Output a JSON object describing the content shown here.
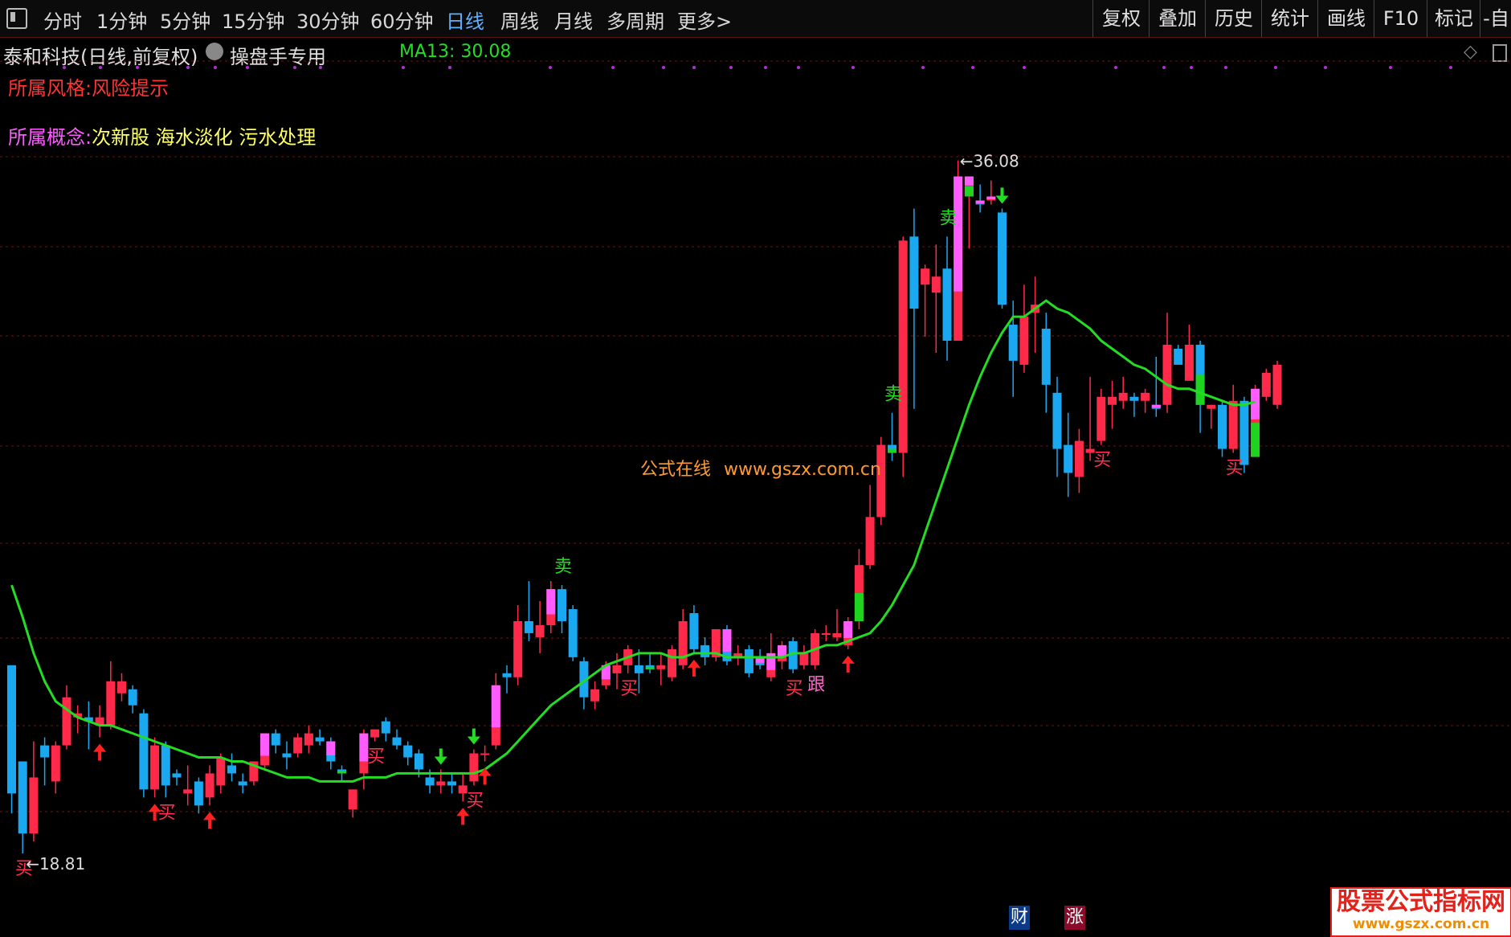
{
  "toolbar": {
    "periods": [
      "分时",
      "1分钟",
      "5分钟",
      "15分钟",
      "30分钟",
      "60分钟",
      "日线",
      "周线",
      "月线",
      "多周期",
      "更多>"
    ],
    "active_period": "日线",
    "right_buttons": [
      "复权",
      "叠加",
      "历史",
      "统计",
      "画线",
      "F10",
      "标记",
      "-自"
    ]
  },
  "header": {
    "stock_title": "泰和科技(日线,前复权)",
    "indicator_name": "操盘手专用",
    "ma_label": "MA13: 30.08",
    "style_prefix": "所属风格:",
    "style_value": "风险提示",
    "concept_prefix": "所属概念:",
    "concepts": "次新股 海水淡化 污水处理"
  },
  "watermark": {
    "cn": "公式在线",
    "url": "www.gszx.com.cn"
  },
  "bottom_badges": {
    "cai": "财",
    "zhang": "涨"
  },
  "logo": {
    "line1": "股票公式指标网",
    "line2": "www.gszx.com.cn"
  },
  "colors": {
    "up": "#ff2a4a",
    "down": "#1aa8f0",
    "magenta": "#ff5cff",
    "green": "#1fd41f",
    "ma": "#22dd22",
    "grid": "#7a1010",
    "dots": "#b030d0"
  },
  "chart_data": {
    "type": "candlestick",
    "title": "泰和科技(日线,前复权)",
    "ylim": [
      17.7,
      38.7
    ],
    "max_label": "36.08",
    "min_label": "18.81",
    "candles": [
      [
        23.5,
        20.3,
        23.5,
        19.8
      ],
      [
        21.1,
        19.3,
        21.1,
        18.8
      ],
      [
        19.3,
        20.7,
        21.6,
        19.1
      ],
      [
        21.5,
        21.2,
        21.7,
        20.5
      ],
      [
        20.6,
        21.5,
        21.6,
        20.3
      ],
      [
        21.5,
        22.7,
        23.0,
        21.4
      ],
      [
        22.2,
        22.3,
        22.5,
        21.8
      ],
      [
        22.2,
        22.1,
        22.6,
        21.4
      ],
      [
        22.0,
        22.2,
        22.5,
        21.7
      ],
      [
        22.0,
        23.1,
        23.6,
        21.9
      ],
      [
        22.8,
        23.1,
        23.3,
        22.6
      ],
      [
        22.9,
        22.5,
        23.0,
        22.3
      ],
      [
        22.3,
        20.4,
        22.4,
        20.2
      ],
      [
        20.4,
        21.5,
        21.7,
        20.2
      ],
      [
        21.5,
        20.5,
        21.6,
        20.2
      ],
      [
        20.8,
        20.7,
        20.9,
        20.5
      ],
      [
        20.3,
        20.4,
        21.0,
        20.0
      ],
      [
        20.6,
        20.0,
        20.7,
        19.8
      ],
      [
        20.2,
        20.8,
        21.0,
        20.0
      ],
      [
        20.5,
        21.2,
        21.3,
        20.3
      ],
      [
        21.0,
        20.8,
        21.3,
        20.6
      ],
      [
        20.6,
        20.5,
        20.8,
        20.3
      ],
      [
        20.6,
        21.1,
        21.1,
        20.5
      ],
      [
        21.0,
        21.8,
        21.8,
        20.9
      ],
      [
        21.8,
        21.5,
        21.9,
        21.3
      ],
      [
        21.3,
        21.2,
        21.6,
        20.9
      ],
      [
        21.3,
        21.7,
        21.8,
        21.2
      ],
      [
        21.5,
        21.8,
        22.0,
        21.3
      ],
      [
        21.7,
        21.6,
        21.9,
        21.5
      ],
      [
        21.6,
        21.1,
        21.7,
        20.9
      ],
      [
        20.9,
        20.8,
        21.0,
        20.6
      ],
      [
        19.9,
        20.4,
        20.4,
        19.7
      ],
      [
        20.8,
        21.8,
        21.9,
        20.4
      ],
      [
        21.7,
        21.9,
        21.9,
        21.6
      ],
      [
        22.1,
        21.8,
        22.2,
        21.6
      ],
      [
        21.7,
        21.5,
        21.9,
        21.4
      ],
      [
        21.5,
        21.2,
        21.6,
        21.0
      ],
      [
        21.3,
        20.9,
        21.4,
        20.7
      ],
      [
        20.7,
        20.5,
        20.9,
        20.3
      ],
      [
        20.5,
        20.6,
        20.9,
        20.3
      ],
      [
        20.6,
        20.5,
        20.8,
        20.3
      ],
      [
        20.3,
        20.5,
        20.8,
        20.1
      ],
      [
        20.6,
        21.3,
        21.4,
        20.5
      ],
      [
        21.3,
        21.3,
        21.5,
        21.1
      ],
      [
        21.5,
        23.0,
        23.3,
        21.4
      ],
      [
        23.3,
        23.2,
        23.5,
        22.8
      ],
      [
        23.2,
        24.6,
        25.0,
        23.0
      ],
      [
        24.6,
        24.3,
        25.6,
        24.1
      ],
      [
        24.2,
        24.5,
        25.1,
        23.8
      ],
      [
        24.5,
        25.4,
        25.6,
        24.3
      ],
      [
        25.4,
        24.6,
        25.5,
        24.3
      ],
      [
        24.9,
        23.7,
        25.0,
        23.6
      ],
      [
        23.6,
        22.7,
        23.7,
        22.4
      ],
      [
        22.6,
        22.9,
        23.1,
        22.4
      ],
      [
        23.0,
        23.5,
        23.6,
        22.9
      ],
      [
        23.3,
        23.5,
        23.8,
        22.9
      ],
      [
        23.5,
        23.9,
        24.0,
        23.3
      ],
      [
        23.5,
        23.3,
        23.9,
        22.8
      ],
      [
        23.5,
        23.4,
        23.8,
        23.3
      ],
      [
        23.4,
        23.5,
        23.8,
        23.0
      ],
      [
        23.2,
        23.9,
        24.0,
        23.1
      ],
      [
        23.5,
        24.6,
        24.9,
        23.4
      ],
      [
        24.8,
        23.9,
        25.0,
        23.8
      ],
      [
        24.0,
        23.7,
        24.2,
        23.5
      ],
      [
        23.7,
        24.4,
        24.4,
        23.6
      ],
      [
        24.4,
        23.6,
        24.5,
        23.5
      ],
      [
        23.7,
        23.8,
        24.0,
        23.5
      ],
      [
        23.9,
        23.3,
        24.0,
        23.2
      ],
      [
        23.7,
        23.5,
        23.9,
        23.4
      ],
      [
        23.2,
        23.8,
        24.3,
        23.1
      ],
      [
        23.6,
        24.0,
        24.1,
        23.4
      ],
      [
        24.1,
        23.4,
        24.2,
        23.3
      ],
      [
        23.5,
        23.8,
        24.0,
        23.4
      ],
      [
        23.5,
        24.3,
        24.4,
        23.4
      ],
      [
        24.3,
        24.3,
        24.5,
        24.1
      ],
      [
        24.2,
        24.3,
        24.9,
        24.1
      ],
      [
        24.0,
        24.6,
        24.7,
        23.9
      ],
      [
        24.6,
        26.0,
        26.4,
        24.4
      ],
      [
        26.0,
        27.2,
        28.0,
        25.9
      ],
      [
        27.2,
        29.0,
        29.2,
        27.0
      ],
      [
        29.0,
        28.8,
        29.8,
        28.6
      ],
      [
        28.8,
        34.1,
        34.2,
        28.2
      ],
      [
        34.2,
        32.4,
        34.9,
        29.9
      ],
      [
        33.0,
        33.4,
        33.5,
        31.7
      ],
      [
        32.8,
        33.2,
        34.0,
        31.3
      ],
      [
        33.4,
        31.6,
        34.2,
        31.1
      ],
      [
        31.6,
        35.7,
        36.1,
        31.6
      ],
      [
        35.2,
        35.7,
        35.3,
        33.9
      ],
      [
        35.1,
        35.0,
        35.5,
        34.8
      ],
      [
        35.1,
        35.2,
        35.6,
        35.0
      ],
      [
        34.8,
        32.5,
        34.9,
        32.4
      ],
      [
        32.0,
        31.1,
        32.6,
        30.2
      ],
      [
        31.0,
        32.2,
        33.0,
        30.8
      ],
      [
        32.3,
        32.5,
        33.2,
        31.3
      ],
      [
        31.9,
        30.5,
        32.3,
        29.8
      ],
      [
        30.3,
        28.9,
        30.7,
        28.2
      ],
      [
        29.0,
        28.3,
        29.8,
        27.7
      ],
      [
        28.2,
        29.1,
        29.4,
        27.8
      ],
      [
        28.8,
        28.9,
        30.7,
        28.6
      ],
      [
        29.1,
        30.2,
        30.4,
        29.0
      ],
      [
        30.0,
        30.2,
        30.6,
        29.4
      ],
      [
        30.1,
        30.3,
        30.7,
        29.9
      ],
      [
        30.2,
        30.1,
        30.3,
        29.7
      ],
      [
        30.1,
        30.3,
        30.4,
        29.8
      ],
      [
        30.0,
        29.9,
        31.2,
        29.7
      ],
      [
        30.0,
        31.5,
        32.3,
        29.8
      ],
      [
        31.4,
        31.0,
        31.5,
        31.0
      ],
      [
        30.6,
        31.5,
        32.0,
        30.6
      ],
      [
        31.5,
        30.0,
        31.6,
        29.3
      ],
      [
        29.9,
        30.0,
        30.0,
        29.4
      ],
      [
        30.0,
        28.9,
        30.1,
        28.7
      ],
      [
        28.9,
        30.1,
        30.5,
        28.8
      ],
      [
        30.1,
        28.5,
        30.2,
        28.3
      ],
      [
        28.7,
        30.4,
        30.5,
        28.7
      ],
      [
        30.2,
        30.8,
        30.9,
        30.1
      ],
      [
        30.0,
        31.0,
        31.1,
        29.9
      ]
    ],
    "magenta_candles": [
      23,
      29,
      32,
      44,
      49,
      54,
      65,
      68,
      69,
      70,
      76,
      86,
      87,
      88,
      89,
      104,
      113
    ],
    "green_candles": [
      30,
      58,
      77,
      80,
      87,
      108,
      113
    ],
    "ma13": [
      25.5,
      24.7,
      23.8,
      23.1,
      22.6,
      22.4,
      22.2,
      22.1,
      22.0,
      22.0,
      21.9,
      21.8,
      21.7,
      21.6,
      21.5,
      21.4,
      21.3,
      21.2,
      21.2,
      21.2,
      21.1,
      21.1,
      21.0,
      20.9,
      20.8,
      20.7,
      20.7,
      20.7,
      20.6,
      20.6,
      20.6,
      20.6,
      20.7,
      20.7,
      20.7,
      20.8,
      20.8,
      20.8,
      20.8,
      20.8,
      20.8,
      20.8,
      20.8,
      20.9,
      21.1,
      21.3,
      21.6,
      21.9,
      22.2,
      22.5,
      22.7,
      22.9,
      23.1,
      23.3,
      23.5,
      23.6,
      23.7,
      23.8,
      23.8,
      23.8,
      23.7,
      23.7,
      23.8,
      23.8,
      23.8,
      23.7,
      23.7,
      23.7,
      23.7,
      23.7,
      23.7,
      23.8,
      23.8,
      23.9,
      24.0,
      24.0,
      24.1,
      24.2,
      24.3,
      24.6,
      25.0,
      25.5,
      26.0,
      26.8,
      27.6,
      28.4,
      29.2,
      30.0,
      30.7,
      31.3,
      31.8,
      32.2,
      32.2,
      32.4,
      32.6,
      32.4,
      32.3,
      32.1,
      31.9,
      31.6,
      31.4,
      31.2,
      31.0,
      30.9,
      30.7,
      30.5,
      30.4,
      30.4,
      30.3,
      30.2,
      30.1,
      30.0,
      30.0,
      30.08
    ],
    "signals": [
      {
        "i": 1,
        "text": "买",
        "color": "#ff3050"
      },
      {
        "i": 14,
        "text": "买",
        "color": "#ff3050"
      },
      {
        "i": 33,
        "text": "买",
        "color": "#ff3050"
      },
      {
        "i": 42,
        "text": "买",
        "color": "#ff3050"
      },
      {
        "i": 50,
        "text": "卖",
        "color": "#22dd22"
      },
      {
        "i": 56,
        "text": "买",
        "color": "#ff3050"
      },
      {
        "i": 71,
        "text": "买",
        "color": "#ff3050"
      },
      {
        "i": 73,
        "text": "跟",
        "color": "#ff66cc"
      },
      {
        "i": 80,
        "text": "卖",
        "color": "#22dd22"
      },
      {
        "i": 85,
        "text": "卖",
        "color": "#22dd22"
      },
      {
        "i": 99,
        "text": "买",
        "color": "#ff3050"
      },
      {
        "i": 111,
        "text": "买",
        "color": "#ff3050"
      }
    ],
    "up_arrows": [
      8,
      13,
      18,
      41,
      43,
      62,
      76
    ],
    "down_arrows": [
      39,
      42,
      90
    ]
  }
}
